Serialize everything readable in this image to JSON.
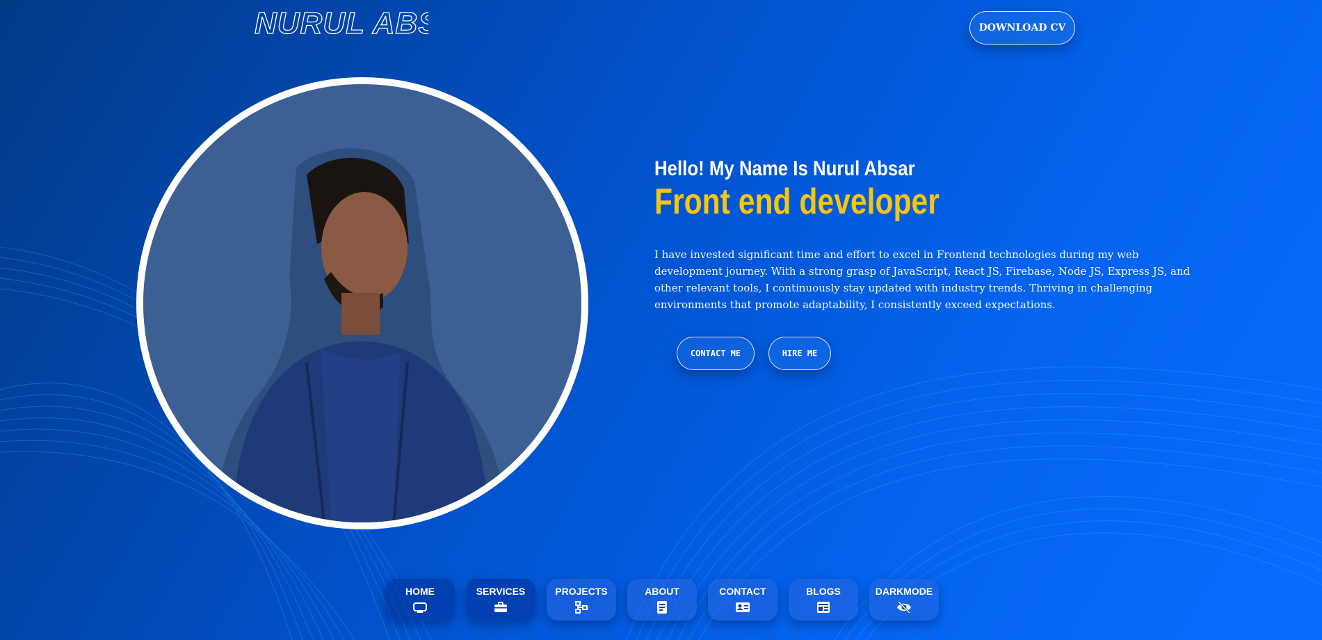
{
  "header": {
    "logo_text": "NURUL ABSAR",
    "download_cv_label": "DOWNLOAD CV"
  },
  "hero": {
    "greeting": "Hello! My Name Is Nurul Absar",
    "role": "Front end developer",
    "bio": "I have invested significant time and effort to excel in Frontend technologies during my web development journey. With a strong grasp of JavaScript, React JS, Firebase, Node JS, Express JS, and other relevant tools, I continuously stay updated with industry trends. Thriving in challenging environments that promote adaptability, I consistently exceed expectations.",
    "contact_label": "CONTACT ME",
    "hire_label": "HIRE ME",
    "portrait_icon": "profile-photo"
  },
  "nav": {
    "items": [
      {
        "label": "HOME",
        "icon": "monitor-icon"
      },
      {
        "label": "SERVICES",
        "icon": "briefcase-icon"
      },
      {
        "label": "PROJECTS",
        "icon": "sitemap-icon"
      },
      {
        "label": "ABOUT",
        "icon": "document-icon"
      },
      {
        "label": "CONTACT",
        "icon": "contact-card-icon"
      },
      {
        "label": "BLOGS",
        "icon": "newspaper-icon"
      },
      {
        "label": "DARKMODE",
        "icon": "eye-slash-icon"
      }
    ]
  },
  "colors": {
    "accent": "#f7c512",
    "background_dark": "#013a86",
    "background_light": "#0a6cff"
  }
}
